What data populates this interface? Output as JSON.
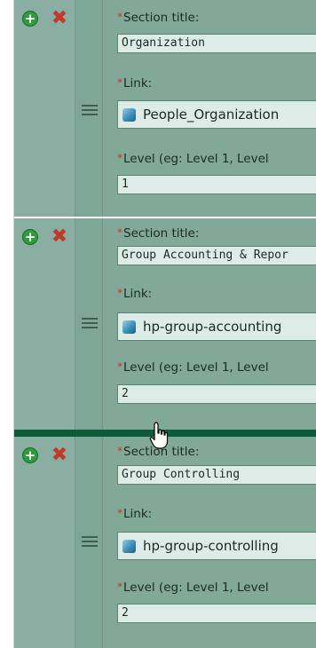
{
  "labels": {
    "section_title": "Section title:",
    "link": "Link:",
    "level": "Level (eg: Level 1, Level"
  },
  "required_marker": "*",
  "sections": [
    {
      "section_title": "Organization",
      "link": "People_Organization",
      "level": "1"
    },
    {
      "section_title": "Group Accounting & Repor",
      "link": "hp-group-accounting",
      "level": "2"
    },
    {
      "section_title": "Group Controlling",
      "link": "hp-group-controlling",
      "level": "2"
    }
  ],
  "icons": {
    "add": "plus-circle-icon",
    "delete": "x-icon",
    "drag": "drag-handle-icon",
    "page": "cube-icon",
    "cursor": "hand-pointer-icon"
  },
  "colors": {
    "panel": "#8aafa2",
    "drop_indicator": "#0e5b3b",
    "add": "#2f9a3e",
    "delete": "#c0392b"
  }
}
